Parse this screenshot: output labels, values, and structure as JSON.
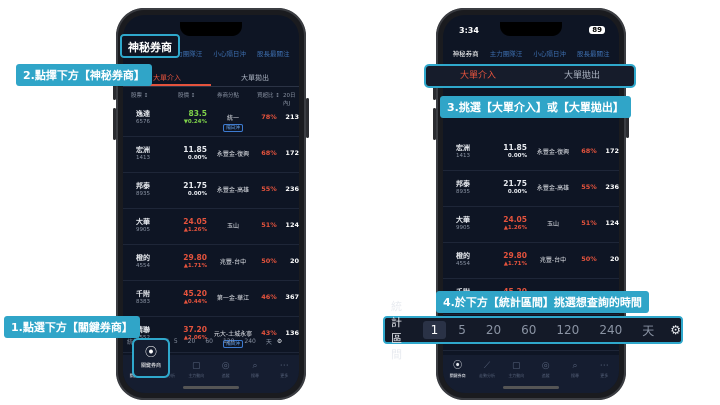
{
  "left_phone": {
    "broker_tabs": [
      "神秘券商",
      "主力團隊汪",
      "小心隔日沖",
      "股長最關注"
    ],
    "segments": [
      "大單介入",
      "大單拋出"
    ],
    "columns": [
      "股票 ↕",
      "股價 ↕",
      "券商分點",
      "買超比 ↕",
      "20日內J"
    ],
    "rows": [
      {
        "name": "逸達",
        "code": "6576",
        "price": "83.5",
        "chg": "▼0.24%",
        "branch": "統一",
        "tag": "隔日沖",
        "pct": "78%",
        "vol": "213",
        "color": "green"
      },
      {
        "name": "宏洲",
        "code": "1413",
        "price": "11.85",
        "chg": "0.00%",
        "branch": "永豐金-復興",
        "tag": "",
        "pct": "68%",
        "vol": "172",
        "color": "flat"
      },
      {
        "name": "邦泰",
        "code": "8935",
        "price": "21.75",
        "chg": "0.00%",
        "branch": "永豐金-高雄",
        "tag": "",
        "pct": "55%",
        "vol": "236",
        "color": "flat"
      },
      {
        "name": "大華",
        "code": "9905",
        "price": "24.05",
        "chg": "▲1.26%",
        "branch": "玉山",
        "tag": "",
        "pct": "51%",
        "vol": "124",
        "color": "up"
      },
      {
        "name": "橙的",
        "code": "4554",
        "price": "29.80",
        "chg": "▲1.71%",
        "branch": "兆豐-台中",
        "tag": "",
        "pct": "50%",
        "vol": "20",
        "color": "up"
      },
      {
        "name": "千附",
        "code": "8383",
        "price": "45.20",
        "chg": "▲0.44%",
        "branch": "第一金-華江",
        "tag": "",
        "pct": "46%",
        "vol": "367",
        "color": "up"
      },
      {
        "name": "精聯",
        "code": "3552",
        "price": "37.20",
        "chg": "▲2.06%",
        "branch": "元大-土城永寧",
        "tag": "隔日沖",
        "pct": "43%",
        "vol": "136",
        "color": "up"
      }
    ],
    "range_label": "統計區間",
    "range_options": [
      "1",
      "5",
      "20",
      "60",
      "120",
      "240",
      "天"
    ],
    "tabs": [
      {
        "icon": "⦿",
        "label": "關鍵券商"
      },
      {
        "icon": "⟋",
        "label": "走勢分析"
      },
      {
        "icon": "▢",
        "label": "主力動向"
      },
      {
        "icon": "◎",
        "label": "追蹤"
      },
      {
        "icon": "⌕",
        "label": "搜尋"
      },
      {
        "icon": "⋯",
        "label": "更多"
      }
    ]
  },
  "right_phone": {
    "time": "3:34",
    "battery": "89",
    "broker_tabs": [
      "神秘券商",
      "主力團隊汪",
      "小心隔日沖",
      "股長最關注"
    ],
    "segments": [
      "大單介入",
      "大單拋出"
    ],
    "rows": [
      {
        "name": "宏洲",
        "code": "1413",
        "price": "11.85",
        "chg": "0.00%",
        "branch": "永豐金-復興",
        "pct": "68%",
        "vol": "172",
        "color": "flat"
      },
      {
        "name": "邦泰",
        "code": "8935",
        "price": "21.75",
        "chg": "0.00%",
        "branch": "永豐金-高雄",
        "pct": "55%",
        "vol": "236",
        "color": "flat"
      },
      {
        "name": "大華",
        "code": "9905",
        "price": "24.05",
        "chg": "▲1.26%",
        "branch": "玉山",
        "pct": "51%",
        "vol": "124",
        "color": "up"
      },
      {
        "name": "橙的",
        "code": "4554",
        "price": "29.80",
        "chg": "▲1.71%",
        "branch": "兆豐-台中",
        "pct": "50%",
        "vol": "20",
        "color": "up"
      },
      {
        "name": "千附",
        "code": "8383",
        "price": "45.20",
        "chg": "▲0.44%",
        "branch": "第一金-華江",
        "pct": "46%",
        "vol": "367",
        "color": "up"
      },
      {
        "name": "精聯",
        "code": "3552",
        "price": "37.20",
        "chg": "▲2.06%",
        "branch": "元大-土城永寧",
        "pct": "43%",
        "vol": "136",
        "color": "up"
      }
    ],
    "range_label": "統計區間",
    "range_options": [
      "1",
      "5",
      "20",
      "60",
      "120",
      "240",
      "天"
    ]
  },
  "callouts": {
    "step1": "1.點選下方【關鍵券商】",
    "step2": "2.點擇下方【神秘券商】",
    "step3": "3.挑選【大單介入】或【大單拋出】",
    "step4": "4.於下方【統計區間】挑選想查詢的時間",
    "broker_zoom": "神秘券商",
    "pin_label": "關鍵券商"
  },
  "colors": {
    "accent": "#30a5c8",
    "up": "#e5533d",
    "down": "#7fd34a",
    "bg": "#0e1524"
  }
}
